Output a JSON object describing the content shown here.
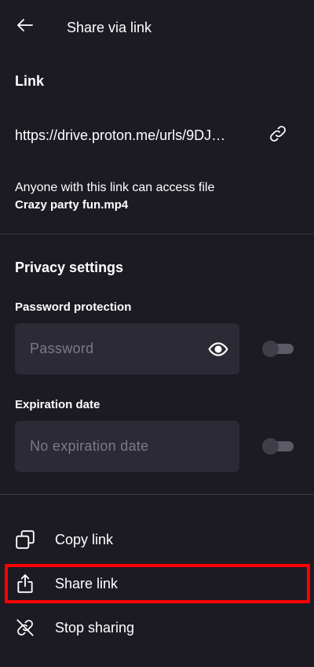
{
  "header": {
    "title": "Share via link",
    "back_icon": "arrow-left-icon"
  },
  "link_section": {
    "heading": "Link",
    "url": "https://drive.proton.me/urls/9DJ…",
    "copy_icon": "link-icon",
    "access_text": "Anyone with this link can access file",
    "file_name": "Crazy party fun.mp4"
  },
  "privacy": {
    "heading": "Privacy settings",
    "password": {
      "label": "Password protection",
      "placeholder": "Password",
      "value": "",
      "toggle_on": false,
      "icon": "eye-icon"
    },
    "expiration": {
      "label": "Expiration date",
      "placeholder": "No expiration date",
      "value": "",
      "toggle_on": false
    }
  },
  "actions": [
    {
      "label": "Copy link",
      "icon": "copy-icon"
    },
    {
      "label": "Share link",
      "icon": "share-icon"
    },
    {
      "label": "Stop sharing",
      "icon": "link-off-icon"
    }
  ],
  "colors": {
    "background": "#1c1b24",
    "field": "#2b2a35",
    "divider": "#3a3944",
    "highlight": "#ff0000"
  }
}
